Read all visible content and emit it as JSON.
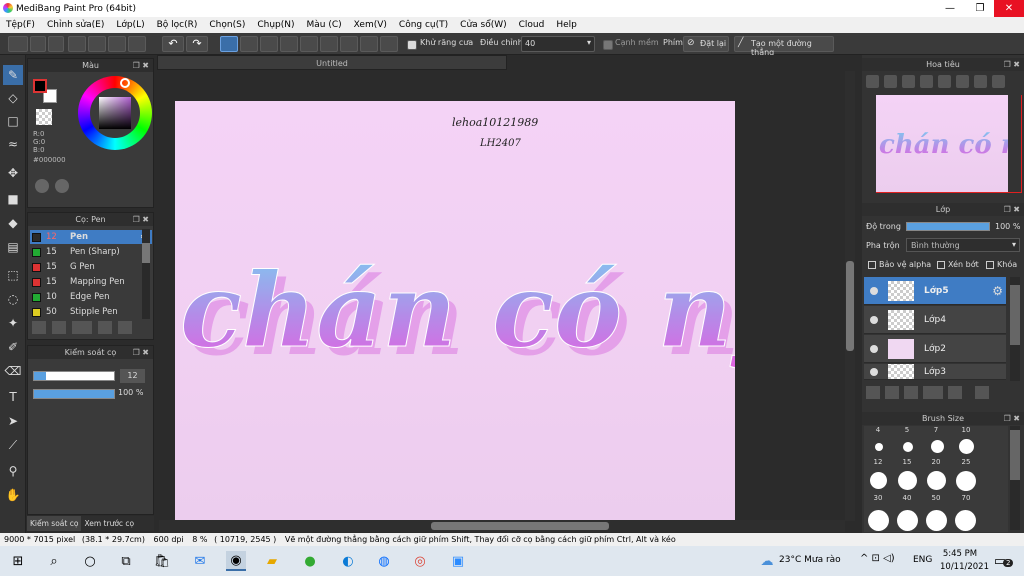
{
  "app": {
    "title": "MediBang Paint Pro (64bit)"
  },
  "window_controls": {
    "minimize": "—",
    "maximize": "❐",
    "close": "✕"
  },
  "menu": [
    "Tệp(F)",
    "Chỉnh sửa(E)",
    "Lớp(L)",
    "Bộ lọc(R)",
    "Chọn(S)",
    "Chụp(N)",
    "Màu (C)",
    "Xem(V)",
    "Công cụ(T)",
    "Cửa sổ(W)",
    "Cloud",
    "Help"
  ],
  "toolbar": {
    "antialias_label": "Khử răng cưa",
    "adjust_label": "Điều chỉnh",
    "adjust_value": "40",
    "soft_edge_label": "Cạnh mềm",
    "key_label": "Phím",
    "reset_label": "Đặt lại",
    "straight_line_label": "Tạo một đường thẳng"
  },
  "color_panel": {
    "title": "Màu",
    "r": "R:0",
    "g": "G:0",
    "b": "B:0",
    "hex": "#000000",
    "primary_color": "#000000",
    "secondary_color": "#ffffff"
  },
  "brush_panel": {
    "title": "Cọ: Pen",
    "items": [
      {
        "size": "12",
        "name": "Pen",
        "color": "#2b2b2b",
        "selected": true
      },
      {
        "size": "15",
        "name": "Pen (Sharp)",
        "color": "#22aa33"
      },
      {
        "size": "15",
        "name": "G Pen",
        "color": "#dd3333"
      },
      {
        "size": "15",
        "name": "Mapping Pen",
        "color": "#dd3333"
      },
      {
        "size": "10",
        "name": "Edge Pen",
        "color": "#22aa33"
      },
      {
        "size": "50",
        "name": "Stipple Pen",
        "color": "#ddcc22"
      }
    ]
  },
  "brush_control": {
    "title": "Kiểm soát cọ",
    "size_value": "12",
    "size_fraction": 0.15,
    "opacity_value": "100 %",
    "opacity_fraction": 1.0
  },
  "bottom_tabs": {
    "brush_control": "Kiểm soát cọ",
    "preview": "Xem trước cọ"
  },
  "document": {
    "tab_title": "Untitled",
    "handwritten_note_1": "lehoa10121989",
    "handwritten_note_2": "LH2407",
    "lettering": "chán có ny"
  },
  "navigator": {
    "title": "Hoa tiêu"
  },
  "layer_panel": {
    "title": "Lớp",
    "opacity_label": "Độ trong",
    "opacity_value": "100 %",
    "blend_label": "Pha trộn",
    "blend_value": "Bình thường",
    "protect_alpha": "Bảo vệ alpha",
    "clipping": "Xén bớt",
    "lock": "Khóa",
    "layers": [
      "Lớp5",
      "Lớp4",
      "Lớp2",
      "Lớp3"
    ]
  },
  "brush_size_panel": {
    "title": "Brush Size",
    "row0": [
      "4",
      "5",
      "7",
      "10"
    ],
    "row1": [
      "12",
      "15",
      "20",
      "25"
    ],
    "row2": [
      "30",
      "40",
      "50",
      "70"
    ]
  },
  "status": {
    "dimensions": "9000 * 7015 pixel",
    "size_cm": "(38.1 * 29.7cm)",
    "dpi": "600 dpi",
    "zoom": "8 %",
    "coords": "( 10719, 2545 )",
    "hint": "Vẽ một đường thẳng bằng cách giữ phím Shift, Thay đổi cỡ cọ bằng cách giữ phím Ctrl, Alt và kéo"
  },
  "taskbar": {
    "weather": "23°C  Mưa rào",
    "lang": "ENG",
    "time": "5:45 PM",
    "date": "10/11/2021",
    "notifications": "2"
  },
  "colors": {
    "accent": "#3a6ea8",
    "canvas_bg": "#f4d3f6",
    "selected_layer": "#3f7cc4"
  }
}
